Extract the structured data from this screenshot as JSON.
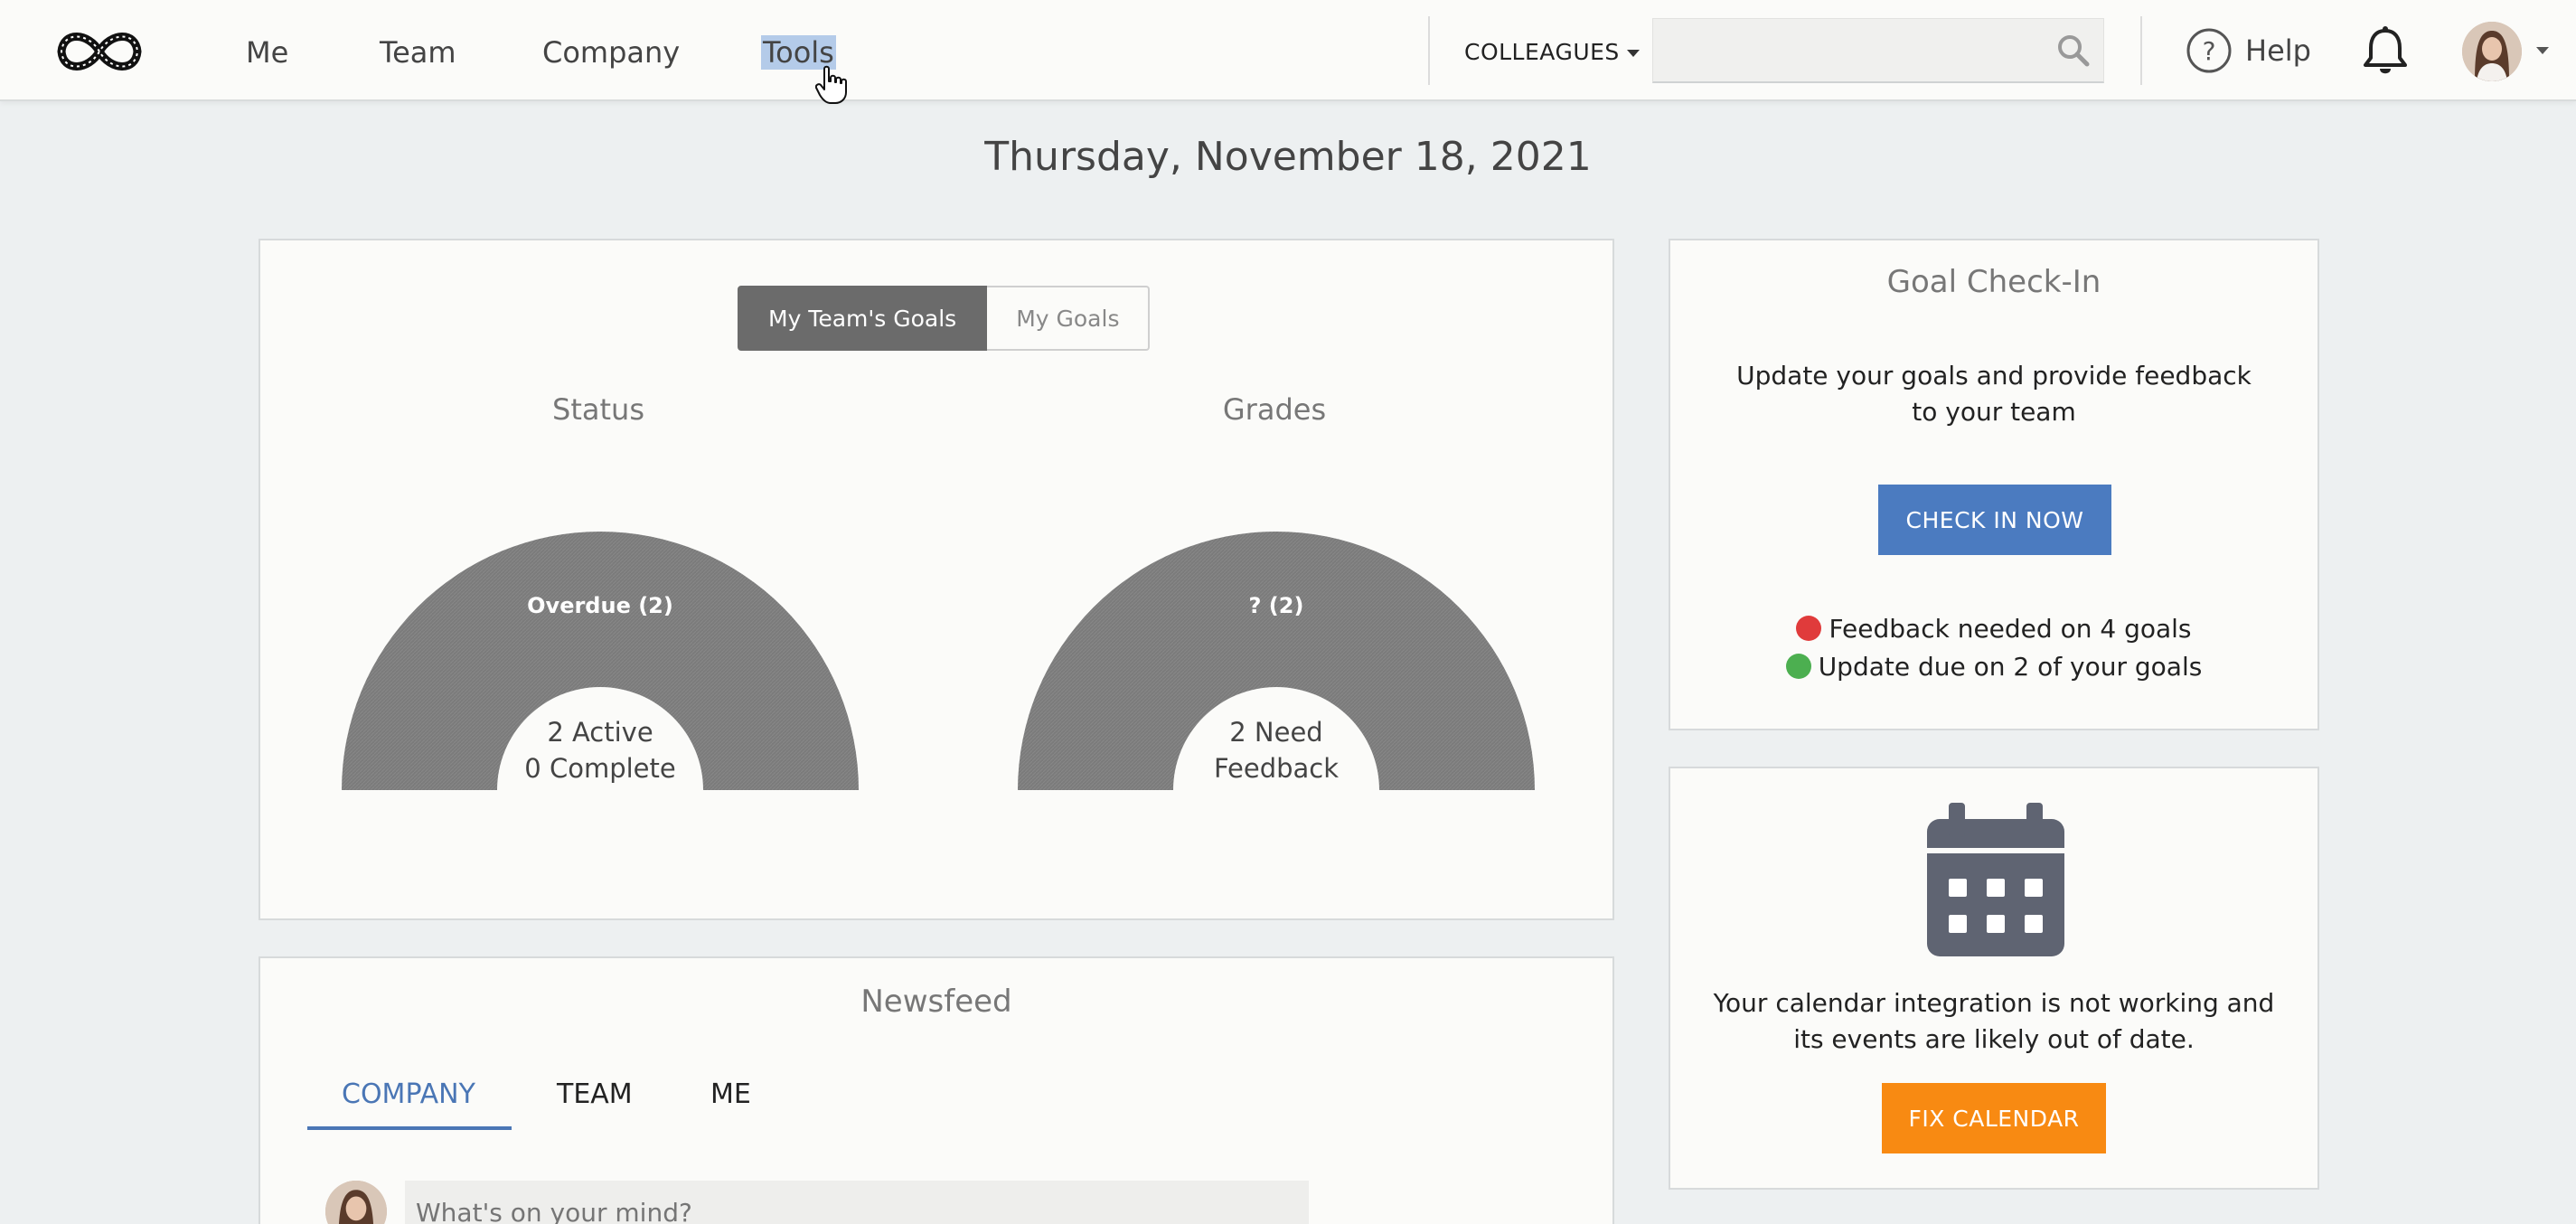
{
  "nav": {
    "items": [
      {
        "label": "Me"
      },
      {
        "label": "Team"
      },
      {
        "label": "Company"
      },
      {
        "label": "Tools"
      }
    ],
    "colleagues_label": "COLLEAGUES",
    "search_placeholder": "",
    "help_label": "Help"
  },
  "date": "Thursday, November 18, 2021",
  "goals": {
    "toggle": [
      "My Team's Goals",
      "My Goals"
    ],
    "status": {
      "title": "Status",
      "segment_label": "Overdue (2)",
      "center_line1": "2 Active",
      "center_line2": "0 Complete"
    },
    "grades": {
      "title": "Grades",
      "segment_label": "? (2)",
      "center_line1": "2 Need",
      "center_line2": "Feedback"
    }
  },
  "newsfeed": {
    "title": "Newsfeed",
    "tabs": [
      "COMPANY",
      "TEAM",
      "ME"
    ],
    "post_placeholder": "What's on your mind?"
  },
  "checkin": {
    "title": "Goal Check-In",
    "text_line1": "Update your goals and provide feedback",
    "text_line2": "to your team",
    "button": "CHECK IN NOW",
    "feedback_needed": "Feedback needed on 4 goals",
    "update_due": "Update due on 2 of your goals"
  },
  "calendar": {
    "text_line1": "Your calendar integration is not working and",
    "text_line2": "its events are likely out of date.",
    "button": "FIX CALENDAR"
  },
  "colors": {
    "accent_blue": "#4b7bc0",
    "accent_orange": "#f88a12",
    "red_dot": "#e03b3b",
    "green_dot": "#4caf50",
    "gauge_gray": "#7b7b7b"
  }
}
